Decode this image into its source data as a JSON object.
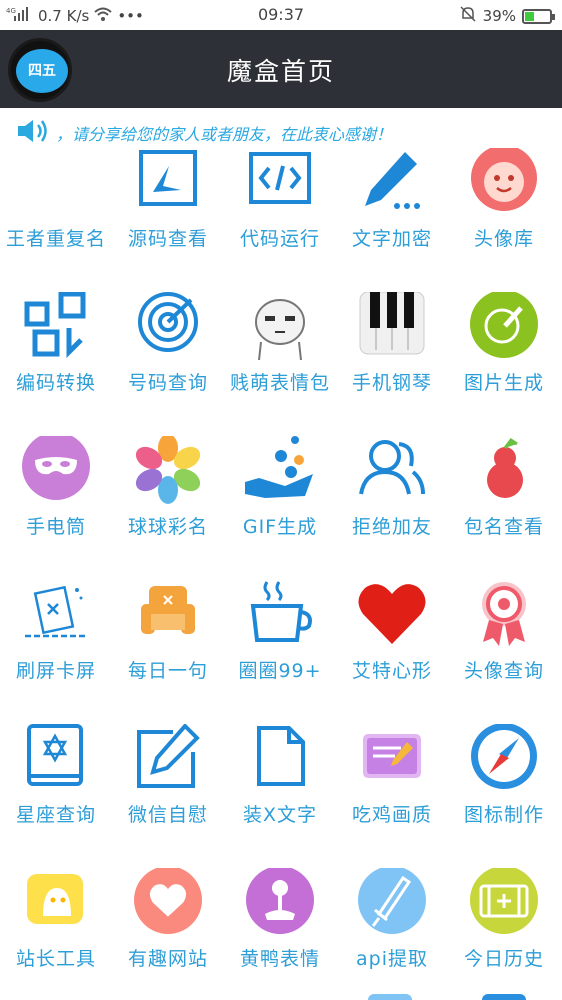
{
  "status_bar": {
    "signal": "4G",
    "speed": "0.7 K/s",
    "dots": "•••",
    "time": "09:37",
    "battery": "39%",
    "battery_level": 0.39
  },
  "header": {
    "title": "魔盒首页",
    "avatar_text": "四五"
  },
  "notice": {
    "text": "，请分享给您的家人或者朋友，在此衷心感谢！"
  },
  "grid": {
    "items": [
      {
        "label": "王者重复名",
        "icon": "crown-icon"
      },
      {
        "label": "源码查看",
        "icon": "source-code-icon"
      },
      {
        "label": "代码运行",
        "icon": "code-brackets-icon"
      },
      {
        "label": "文字加密",
        "icon": "pen-icon"
      },
      {
        "label": "头像库",
        "icon": "monkey-avatar-icon"
      },
      {
        "label": "编码转换",
        "icon": "convert-icon"
      },
      {
        "label": "号码查询",
        "icon": "radar-icon"
      },
      {
        "label": "贱萌表情包",
        "icon": "meme-face-icon"
      },
      {
        "label": "手机钢琴",
        "icon": "piano-icon"
      },
      {
        "label": "图片生成",
        "icon": "paint-brush-icon"
      },
      {
        "label": "手电筒",
        "icon": "mask-icon"
      },
      {
        "label": "球球彩名",
        "icon": "flower-petals-icon"
      },
      {
        "label": "GIF生成",
        "icon": "hand-bubbles-icon"
      },
      {
        "label": "拒绝加友",
        "icon": "users-icon"
      },
      {
        "label": "包名查看",
        "icon": "gourd-icon"
      },
      {
        "label": "刷屏卡屏",
        "icon": "broken-card-icon"
      },
      {
        "label": "每日一句",
        "icon": "sofa-icon"
      },
      {
        "label": "圈圈99+",
        "icon": "coffee-cup-icon"
      },
      {
        "label": "艾特心形",
        "icon": "heart-icon"
      },
      {
        "label": "头像查询",
        "icon": "award-badge-icon"
      },
      {
        "label": "星座查询",
        "icon": "star-book-icon"
      },
      {
        "label": "微信自慰",
        "icon": "edit-square-icon"
      },
      {
        "label": "装X文字",
        "icon": "document-icon"
      },
      {
        "label": "吃鸡画质",
        "icon": "notepad-icon"
      },
      {
        "label": "图标制作",
        "icon": "compass-icon"
      },
      {
        "label": "站长工具",
        "icon": "ghost-chat-icon"
      },
      {
        "label": "有趣网站",
        "icon": "heart-chat-icon"
      },
      {
        "label": "黄鸭表情",
        "icon": "joystick-icon"
      },
      {
        "label": "api提取",
        "icon": "sword-icon"
      },
      {
        "label": "今日历史",
        "icon": "film-add-icon"
      }
    ]
  },
  "colors": {
    "header_bg": "#2d3036",
    "accent_blue": "#2e9ed8",
    "icon_blue": "#1e88d6"
  }
}
